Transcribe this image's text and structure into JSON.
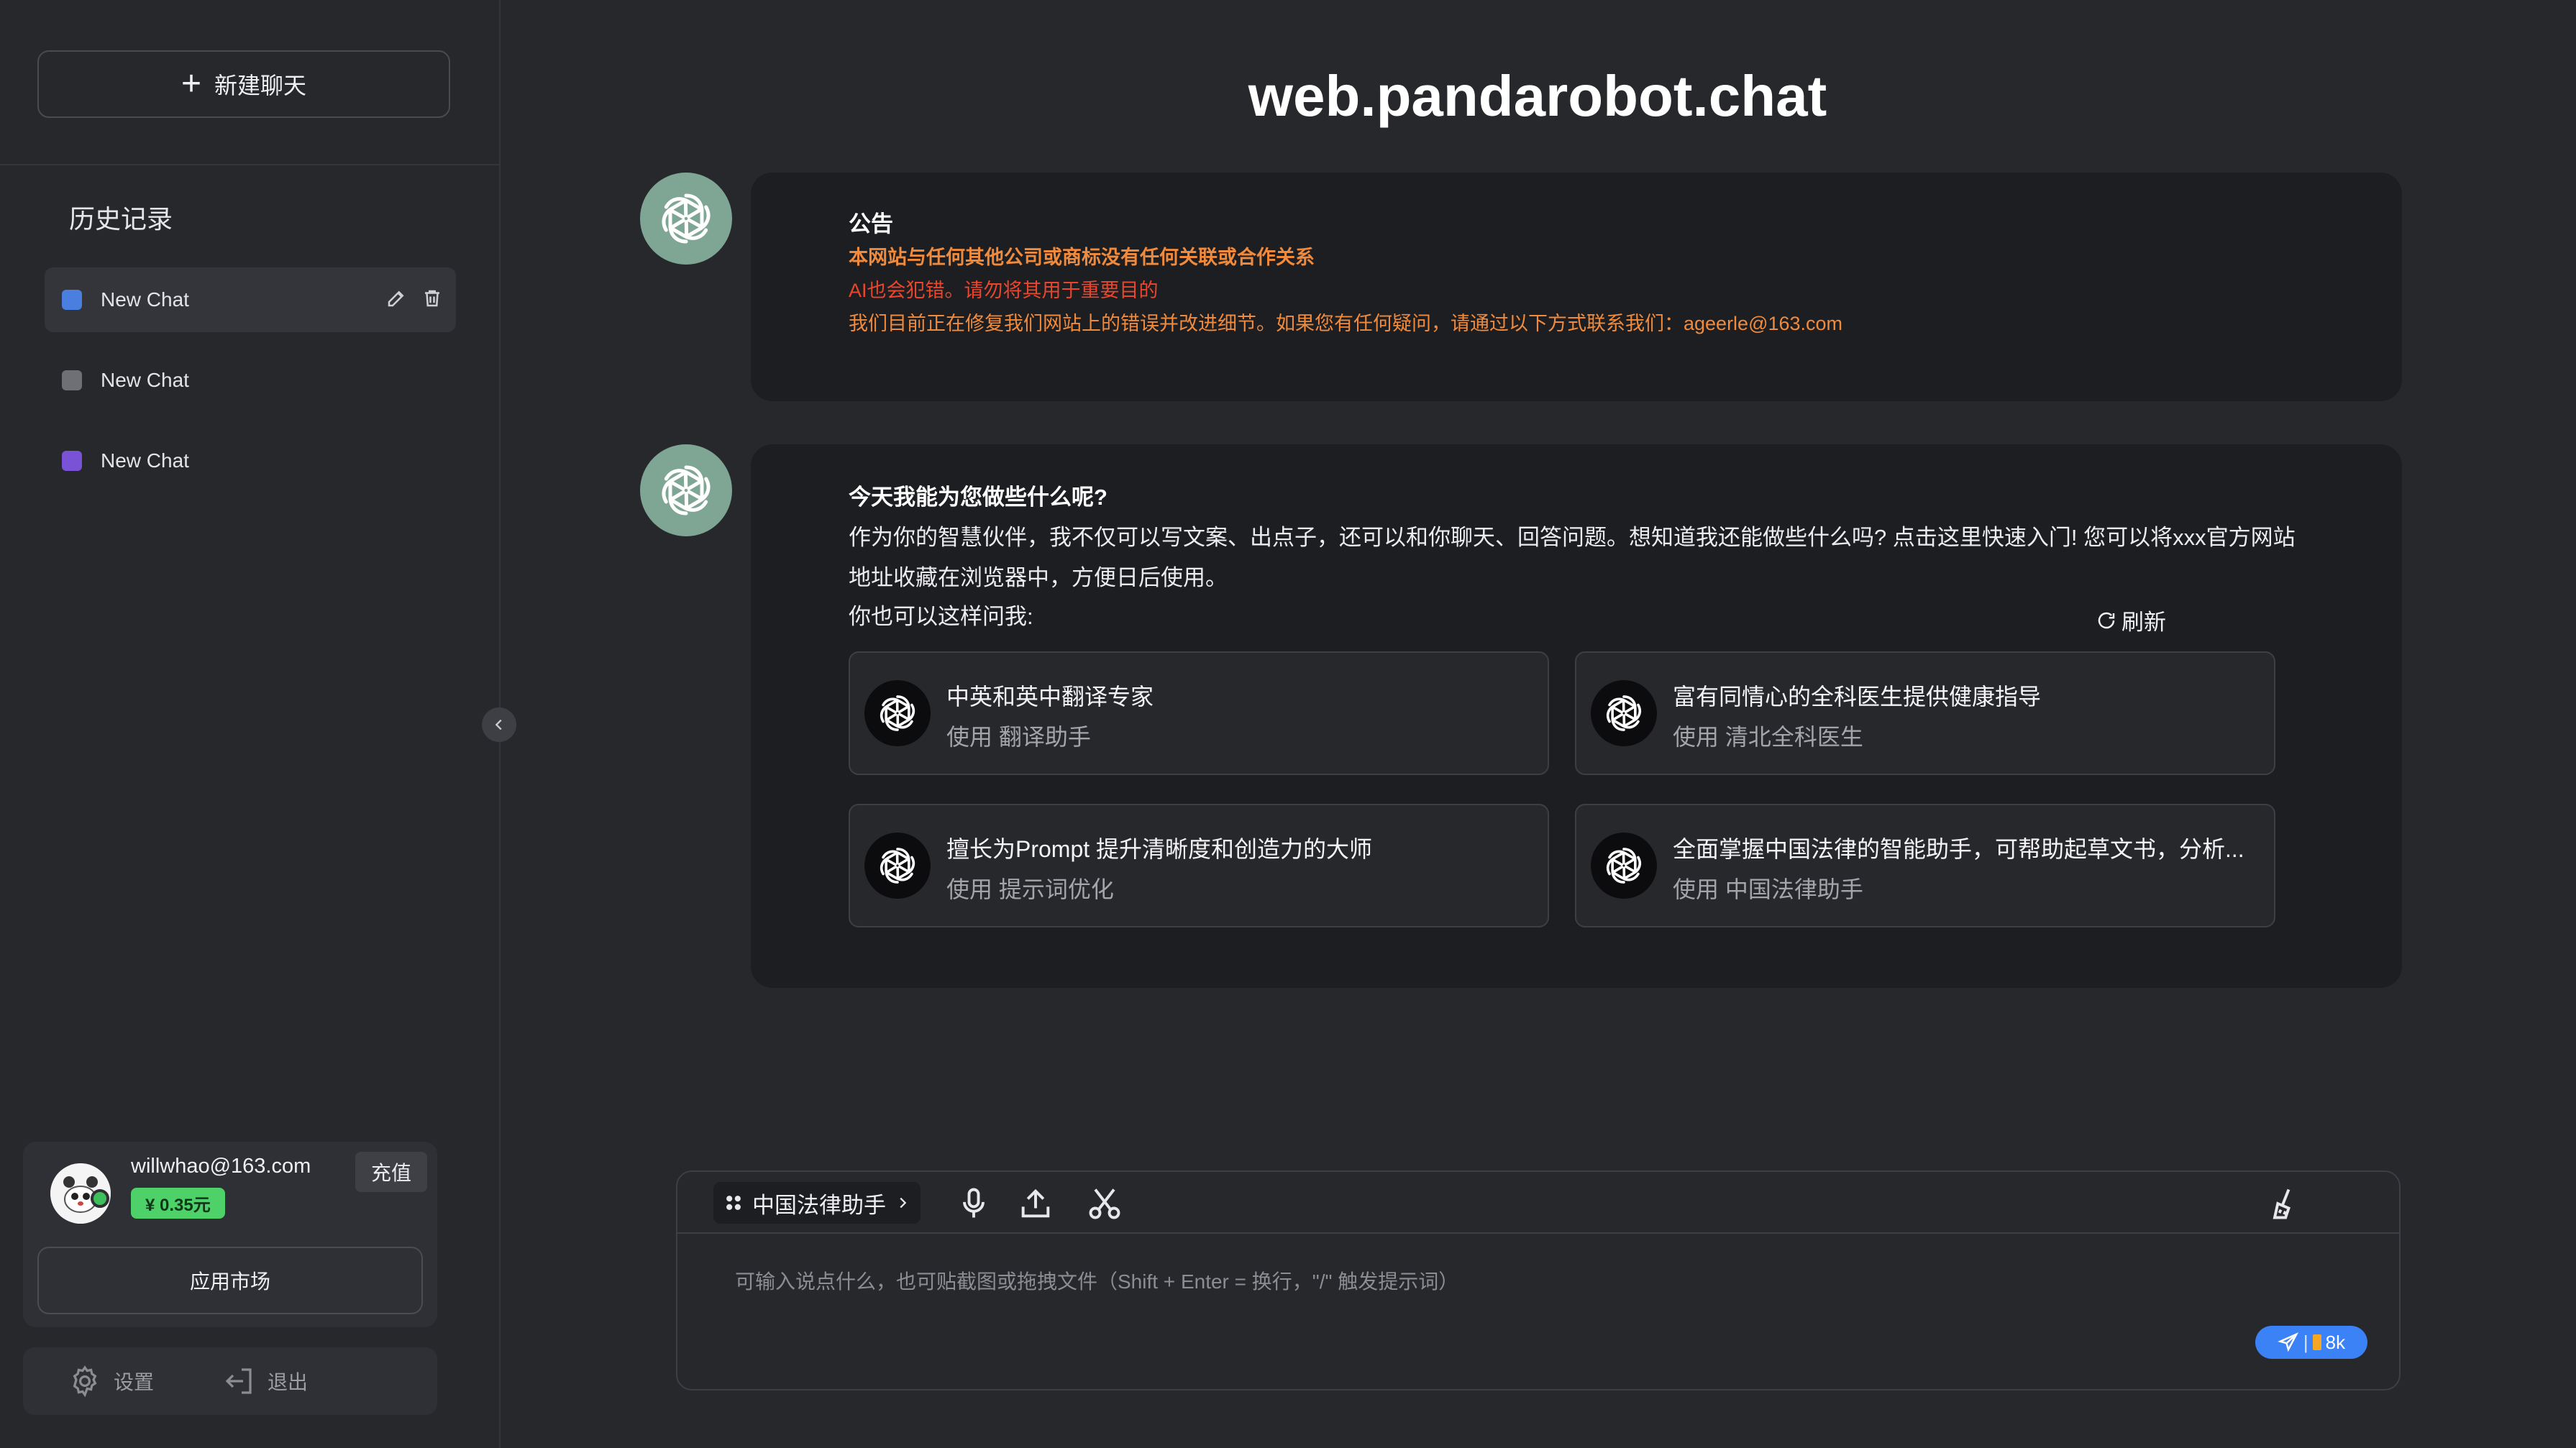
{
  "sidebar": {
    "new_chat_label": "新建聊天",
    "history_title": "历史记录",
    "items": [
      {
        "label": "New Chat",
        "color": "#4a7fe0"
      },
      {
        "label": "New Chat",
        "color": "#6e7075"
      },
      {
        "label": "New Chat",
        "color": "#7a52d6"
      }
    ]
  },
  "user": {
    "email": "willwhao@163.com",
    "balance": "¥ 0.35元",
    "recharge_label": "充值",
    "market_label": "应用市场"
  },
  "footer": {
    "settings_label": "设置",
    "logout_label": "退出"
  },
  "header": {
    "title": "web.pandarobot.chat"
  },
  "announcement": {
    "title": "公告",
    "line1": "本网站与任何其他公司或商标没有任何关联或合作关系",
    "line2": "AI也会犯错。请勿将其用于重要目的",
    "line3": "我们目前正在修复我们网站上的错误并改进细节。如果您有任何疑问，请通过以下方式联系我们：ageerle@163.com",
    "colors": {
      "line1": "#f08a3c",
      "line2": "#e8472e",
      "line3": "#f08a3c"
    }
  },
  "greeting": {
    "title": "今天我能为您做些什么呢?",
    "body": "作为你的智慧伙伴，我不仅可以写文案、出点子，还可以和你聊天、回答问题。想知道我还能做些什么吗? 点击这里快速入门! 您可以将xxx官方网站地址收藏在浏览器中，方便日后使用。",
    "ask": "你也可以这样问我:",
    "refresh_label": "刷新"
  },
  "prompts": [
    {
      "title": "中英和英中翻译专家",
      "sub": "使用 翻译助手"
    },
    {
      "title": "富有同情心的全科医生提供健康指导",
      "sub": "使用 清北全科医生"
    },
    {
      "title": "擅长为Prompt 提升清晰度和创造力的大师",
      "sub": "使用 提示词优化"
    },
    {
      "title": "全面掌握中国法律的智能助手，可帮助起草文书，分析...",
      "sub": "使用 中国法律助手"
    }
  ],
  "input": {
    "assistant_label": "中国法律助手",
    "placeholder": "可输入说点什么，也可贴截图或拖拽文件（Shift + Enter = 换行，\"/\" 触发提示词）",
    "send_count": "8k"
  },
  "icons": {
    "plus": "plus-icon",
    "edit": "edit-icon",
    "delete": "trash-icon",
    "settings": "gear-icon",
    "logout": "logout-icon",
    "collapse": "chevron-left-icon",
    "bot": "openai-logo-icon",
    "refresh": "refresh-icon",
    "grid": "grid-icon",
    "mic": "microphone-icon",
    "upload": "upload-icon",
    "scissors": "scissors-icon",
    "broom": "broom-icon",
    "send": "send-icon"
  }
}
